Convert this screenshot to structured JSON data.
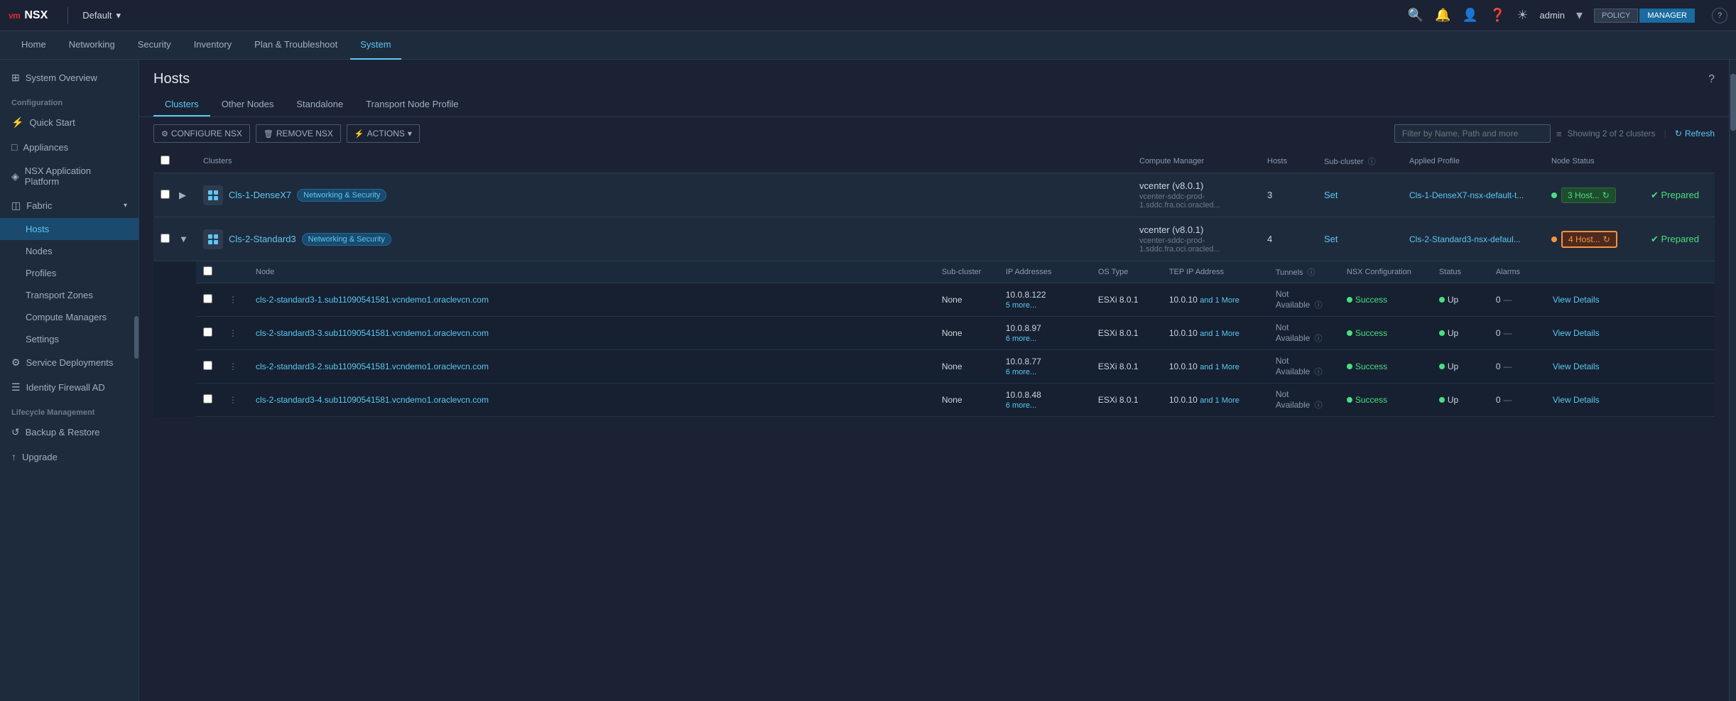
{
  "app": {
    "name": "NSX",
    "vendor": "vm"
  },
  "context": {
    "name": "Default",
    "chevron": "▾"
  },
  "topbar": {
    "icons": [
      "search",
      "bell",
      "user",
      "help",
      "sun"
    ],
    "user": "admin",
    "chevron": "▾"
  },
  "policy_manager": {
    "policy_label": "POLICY",
    "manager_label": "MANAGER",
    "active": "MANAGER"
  },
  "navbar": {
    "items": [
      {
        "id": "home",
        "label": "Home"
      },
      {
        "id": "networking",
        "label": "Networking"
      },
      {
        "id": "security",
        "label": "Security"
      },
      {
        "id": "inventory",
        "label": "Inventory"
      },
      {
        "id": "plan",
        "label": "Plan & Troubleshoot"
      },
      {
        "id": "system",
        "label": "System"
      }
    ],
    "active": "system"
  },
  "sidebar": {
    "items": [
      {
        "id": "system-overview",
        "label": "System Overview",
        "icon": "⊞",
        "type": "item"
      },
      {
        "id": "config-label",
        "label": "Configuration",
        "type": "section"
      },
      {
        "id": "quick-start",
        "label": "Quick Start",
        "icon": "⚡",
        "type": "item"
      },
      {
        "id": "appliances",
        "label": "Appliances",
        "icon": "□",
        "type": "item"
      },
      {
        "id": "nsx-app-platform",
        "label": "NSX Application Platform",
        "icon": "◈",
        "type": "item"
      },
      {
        "id": "fabric",
        "label": "Fabric",
        "icon": "◫",
        "type": "group",
        "expanded": true
      },
      {
        "id": "hosts",
        "label": "Hosts",
        "type": "subitem",
        "active": true
      },
      {
        "id": "nodes",
        "label": "Nodes",
        "type": "subitem"
      },
      {
        "id": "profiles",
        "label": "Profiles",
        "type": "subitem"
      },
      {
        "id": "transport-zones",
        "label": "Transport Zones",
        "type": "subitem"
      },
      {
        "id": "compute-managers",
        "label": "Compute Managers",
        "type": "subitem"
      },
      {
        "id": "settings",
        "label": "Settings",
        "type": "subitem"
      },
      {
        "id": "service-deployments",
        "label": "Service Deployments",
        "icon": "⚙",
        "type": "item"
      },
      {
        "id": "identity-firewall-ad",
        "label": "Identity Firewall AD",
        "icon": "☰",
        "type": "item"
      },
      {
        "id": "lifecycle-label",
        "label": "Lifecycle Management",
        "type": "section"
      },
      {
        "id": "backup-restore",
        "label": "Backup & Restore",
        "icon": "↺",
        "type": "item"
      },
      {
        "id": "upgrade",
        "label": "Upgrade",
        "icon": "↑",
        "type": "item"
      }
    ]
  },
  "page": {
    "title": "Hosts",
    "tabs": [
      {
        "id": "clusters",
        "label": "Clusters",
        "active": true
      },
      {
        "id": "other-nodes",
        "label": "Other Nodes"
      },
      {
        "id": "standalone",
        "label": "Standalone"
      },
      {
        "id": "transport-node-profile",
        "label": "Transport Node Profile"
      }
    ]
  },
  "toolbar": {
    "configure_nsx": "CONFIGURE NSX",
    "remove_nsx": "REMOVE NSX",
    "actions": "ACTIONS",
    "filter_placeholder": "Filter by Name, Path and more",
    "showing_text": "Showing 2 of 2 clusters",
    "refresh_label": "Refresh"
  },
  "table": {
    "columns": [
      {
        "id": "clusters",
        "label": "Clusters"
      },
      {
        "id": "compute-manager",
        "label": "Compute Manager"
      },
      {
        "id": "hosts",
        "label": "Hosts"
      },
      {
        "id": "sub-cluster",
        "label": "Sub-cluster"
      },
      {
        "id": "applied-profile",
        "label": "Applied Profile"
      },
      {
        "id": "node-status",
        "label": "Node Status"
      }
    ],
    "rows": [
      {
        "id": "row1",
        "name": "Cls-1-DenseX7",
        "badge": "Networking & Security",
        "badge_color": "blue",
        "compute_manager": "vcenter (v8.0.1)",
        "compute_sub": "vcenter-sddc-prod-1.sddc.fra.oci.oracled...",
        "hosts": "3",
        "subcluster": "Set",
        "profile": "Cls-1-DenseX7-nsx-default-t...",
        "node_status": "3 Host...",
        "node_status_color": "green",
        "prepared": "Prepared",
        "expanded": false
      },
      {
        "id": "row2",
        "name": "Cls-2-Standard3",
        "badge": "Networking & Security",
        "badge_color": "blue",
        "compute_manager": "vcenter (v8.0.1)",
        "compute_sub": "vcenter-sddc-prod-1.sddc.fra.oci.oracled...",
        "hosts": "4",
        "subcluster": "Set",
        "profile": "Cls-2-Standard3-nsx-defaul...",
        "node_status": "4 Host...",
        "node_status_color": "orange",
        "node_status_highlighted": true,
        "prepared": "Prepared",
        "expanded": true
      }
    ]
  },
  "sub_table": {
    "columns": [
      {
        "id": "node",
        "label": "Node"
      },
      {
        "id": "sub-cluster",
        "label": "Sub-cluster"
      },
      {
        "id": "ip-addresses",
        "label": "IP Addresses"
      },
      {
        "id": "os-type",
        "label": "OS Type"
      },
      {
        "id": "tep-ip",
        "label": "TEP IP Address"
      },
      {
        "id": "tunnels",
        "label": "Tunnels"
      },
      {
        "id": "nsx-config",
        "label": "NSX Configuration"
      },
      {
        "id": "status",
        "label": "Status"
      },
      {
        "id": "alarms",
        "label": "Alarms"
      },
      {
        "id": "action",
        "label": ""
      }
    ],
    "rows": [
      {
        "node": "cls-2-standard3-1.sub11090541581.vcndemo1.oraclevcn.com",
        "sub_cluster": "None",
        "ip": "10.0.8.122",
        "ip_more": "5 more...",
        "os_type": "ESXi 8.0.1",
        "tep_ip": "10.0.10",
        "tep_more": "and 1 More",
        "tunnels": "Not Available",
        "nsx_config": "Success",
        "status": "Up",
        "alarms": "0",
        "action": "View Details"
      },
      {
        "node": "cls-2-standard3-3.sub11090541581.vcndemo1.oraclevcn.com",
        "sub_cluster": "None",
        "ip": "10.0.8.97",
        "ip_more": "6 more...",
        "os_type": "ESXi 8.0.1",
        "tep_ip": "10.0.10",
        "tep_more": "and 1 More",
        "tunnels": "Not Available",
        "nsx_config": "Success",
        "status": "Up",
        "alarms": "0",
        "action": "View Details"
      },
      {
        "node": "cls-2-standard3-2.sub11090541581.vcndemo1.oraclevcn.com",
        "sub_cluster": "None",
        "ip": "10.0.8.77",
        "ip_more": "6 more...",
        "os_type": "ESXi 8.0.1",
        "tep_ip": "10.0.10",
        "tep_more": "and 1 More",
        "tunnels": "Not Available",
        "nsx_config": "Success",
        "status": "Up",
        "alarms": "0",
        "action": "View Details"
      },
      {
        "node": "cls-2-standard3-4.sub11090541581.vcndemo1.oraclevcn.com",
        "sub_cluster": "None",
        "ip": "10.0.8.48",
        "ip_more": "6 more...",
        "os_type": "ESXi 8.0.1",
        "tep_ip": "10.0.10",
        "tep_more": "and 1 More",
        "tunnels": "Not Available",
        "nsx_config": "Success",
        "status": "Up",
        "alarms": "0",
        "action": "View Details"
      }
    ]
  }
}
